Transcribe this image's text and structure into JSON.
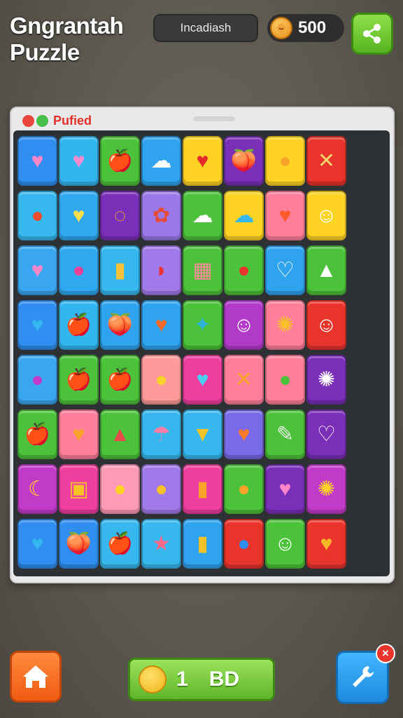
{
  "header": {
    "title_line1": "Gngrantah",
    "title_line2": "Puzzle",
    "status_label": "Incadiash",
    "coins": "500",
    "coin_icon": "coin-icon",
    "share_icon": "share-icon"
  },
  "panel": {
    "title": "Pufied",
    "dot_colors": [
      "#e8453c",
      "#46c04a"
    ]
  },
  "board": {
    "rows": [
      [
        {
          "c": "#2f8ef0",
          "g": "♥",
          "f": "#ff86c8"
        },
        {
          "c": "#33b6ef",
          "g": "♥",
          "f": "#ff8ad0"
        },
        {
          "c": "#4cc23a",
          "g": "🍎",
          "f": "#e33"
        },
        {
          "c": "#2fa3ee",
          "g": "☁",
          "f": "#fff"
        },
        {
          "c": "#ffd323",
          "g": "♥",
          "f": "#e52b2b"
        },
        {
          "c": "#7a2fb8",
          "g": "🍑",
          "f": "#f46a2c"
        },
        {
          "c": "#ffd323",
          "g": "●",
          "f": "#f7a428"
        },
        {
          "c": "#e8342b",
          "g": "✕",
          "f": "#f4d36a"
        }
      ],
      [
        {
          "c": "#36b8ee",
          "g": "●",
          "f": "#ec4a2a"
        },
        {
          "c": "#30a8ef",
          "g": "♥",
          "f": "#ffe04a"
        },
        {
          "c": "#7a2fb8",
          "g": "◌",
          "f": "#f7b728"
        },
        {
          "c": "#9a78e8",
          "g": "✿",
          "f": "#e84a3a"
        },
        {
          "c": "#4cc23a",
          "g": "☁",
          "f": "#fff"
        },
        {
          "c": "#ffd323",
          "g": "☁",
          "f": "#36b8ee"
        },
        {
          "c": "#ff7f9a",
          "g": "♥",
          "f": "#ff5a2a"
        },
        {
          "c": "#ffd323",
          "g": "☺",
          "f": "#fff"
        }
      ],
      [
        {
          "c": "#3aa6f0",
          "g": "♥",
          "f": "#ff86c8"
        },
        {
          "c": "#30a8ef",
          "g": "●",
          "f": "#ee3f9a"
        },
        {
          "c": "#36b8ee",
          "g": "▮",
          "f": "#f5c23a"
        },
        {
          "c": "#a07ae8",
          "g": "◗",
          "f": "#e33"
        },
        {
          "c": "#4cc23a",
          "g": "▦",
          "f": "#ff8a9a"
        },
        {
          "c": "#4cc23a",
          "g": "●",
          "f": "#e8342b"
        },
        {
          "c": "#2fa3ee",
          "g": "♡",
          "f": "#fff"
        },
        {
          "c": "#4cc23a",
          "g": "▲",
          "f": "#fff"
        }
      ],
      [
        {
          "c": "#2f8ef0",
          "g": "♥",
          "f": "#35b6f0"
        },
        {
          "c": "#33b6ef",
          "g": "🍎",
          "f": "#e33"
        },
        {
          "c": "#2fa3ee",
          "g": "🍑",
          "f": "#f46a2c"
        },
        {
          "c": "#2fa3ee",
          "g": "♥",
          "f": "#f46a2c"
        },
        {
          "c": "#4cc23a",
          "g": "✦",
          "f": "#2fb0d8"
        },
        {
          "c": "#b13ac8",
          "g": "☺",
          "f": "#fff"
        },
        {
          "c": "#ff7f9a",
          "g": "✺",
          "f": "#f7c228"
        },
        {
          "c": "#e8342b",
          "g": "☺",
          "f": "#fff"
        }
      ],
      [
        {
          "c": "#3aa6f0",
          "g": "●",
          "f": "#c13ac8"
        },
        {
          "c": "#4cc23a",
          "g": "🍎",
          "f": "#e33"
        },
        {
          "c": "#4cc23a",
          "g": "🍎",
          "f": "#e33"
        },
        {
          "c": "#ff9a9a",
          "g": "●",
          "f": "#f7d228"
        },
        {
          "c": "#ee3fa0",
          "g": "♥",
          "f": "#4ad0f0"
        },
        {
          "c": "#ff7f9a",
          "g": "✕",
          "f": "#f7a428"
        },
        {
          "c": "#ff7f9a",
          "g": "●",
          "f": "#4cc23a"
        },
        {
          "c": "#7a2fb8",
          "g": "✺",
          "f": "#fff"
        }
      ],
      [
        {
          "c": "#4cc23a",
          "g": "🍎",
          "f": "#e33"
        },
        {
          "c": "#ff7f9a",
          "g": "♥",
          "f": "#f7a428"
        },
        {
          "c": "#4cc23a",
          "g": "▲",
          "f": "#e84a4a"
        },
        {
          "c": "#36b8ee",
          "g": "☂",
          "f": "#ff7fa8"
        },
        {
          "c": "#36b8ee",
          "g": "▼",
          "f": "#f7c228"
        },
        {
          "c": "#7a6ae8",
          "g": "♥",
          "f": "#ff7a2a"
        },
        {
          "c": "#4cc23a",
          "g": "✎",
          "f": "#e8e8e8"
        },
        {
          "c": "#7a2fb8",
          "g": "♡",
          "f": "#fff"
        }
      ],
      [
        {
          "c": "#c13ac8",
          "g": "☾",
          "f": "#ffd323"
        },
        {
          "c": "#ee3fa0",
          "g": "▣",
          "f": "#f7c228"
        },
        {
          "c": "#ff9ab8",
          "g": "●",
          "f": "#ffd323"
        },
        {
          "c": "#a07ae8",
          "g": "●",
          "f": "#f7c228"
        },
        {
          "c": "#ee3fa0",
          "g": "▮",
          "f": "#f7a428"
        },
        {
          "c": "#4cc23a",
          "g": "●",
          "f": "#f7a428"
        },
        {
          "c": "#7a2fb8",
          "g": "♥",
          "f": "#ff86c8"
        },
        {
          "c": "#c13ac8",
          "g": "✺",
          "f": "#ffd323"
        }
      ],
      [
        {
          "c": "#2f8ef0",
          "g": "♥",
          "f": "#35b6f0"
        },
        {
          "c": "#2f8ef0",
          "g": "🍑",
          "f": "#f46a2c"
        },
        {
          "c": "#36b8ee",
          "g": "🍎",
          "f": "#e33"
        },
        {
          "c": "#36b8ee",
          "g": "★",
          "f": "#ff6a8a"
        },
        {
          "c": "#2fa3ee",
          "g": "▮",
          "f": "#f7c228"
        },
        {
          "c": "#e8342b",
          "g": "●",
          "f": "#2f8ef0"
        },
        {
          "c": "#4cc23a",
          "g": "☺",
          "f": "#fff"
        },
        {
          "c": "#e8342b",
          "g": "♥",
          "f": "#f7b728"
        }
      ]
    ]
  },
  "footer": {
    "home_icon": "home-icon",
    "score_value": "1",
    "score_label": "BD",
    "tool_icon": "wrench-icon",
    "close_symbol": "×"
  }
}
